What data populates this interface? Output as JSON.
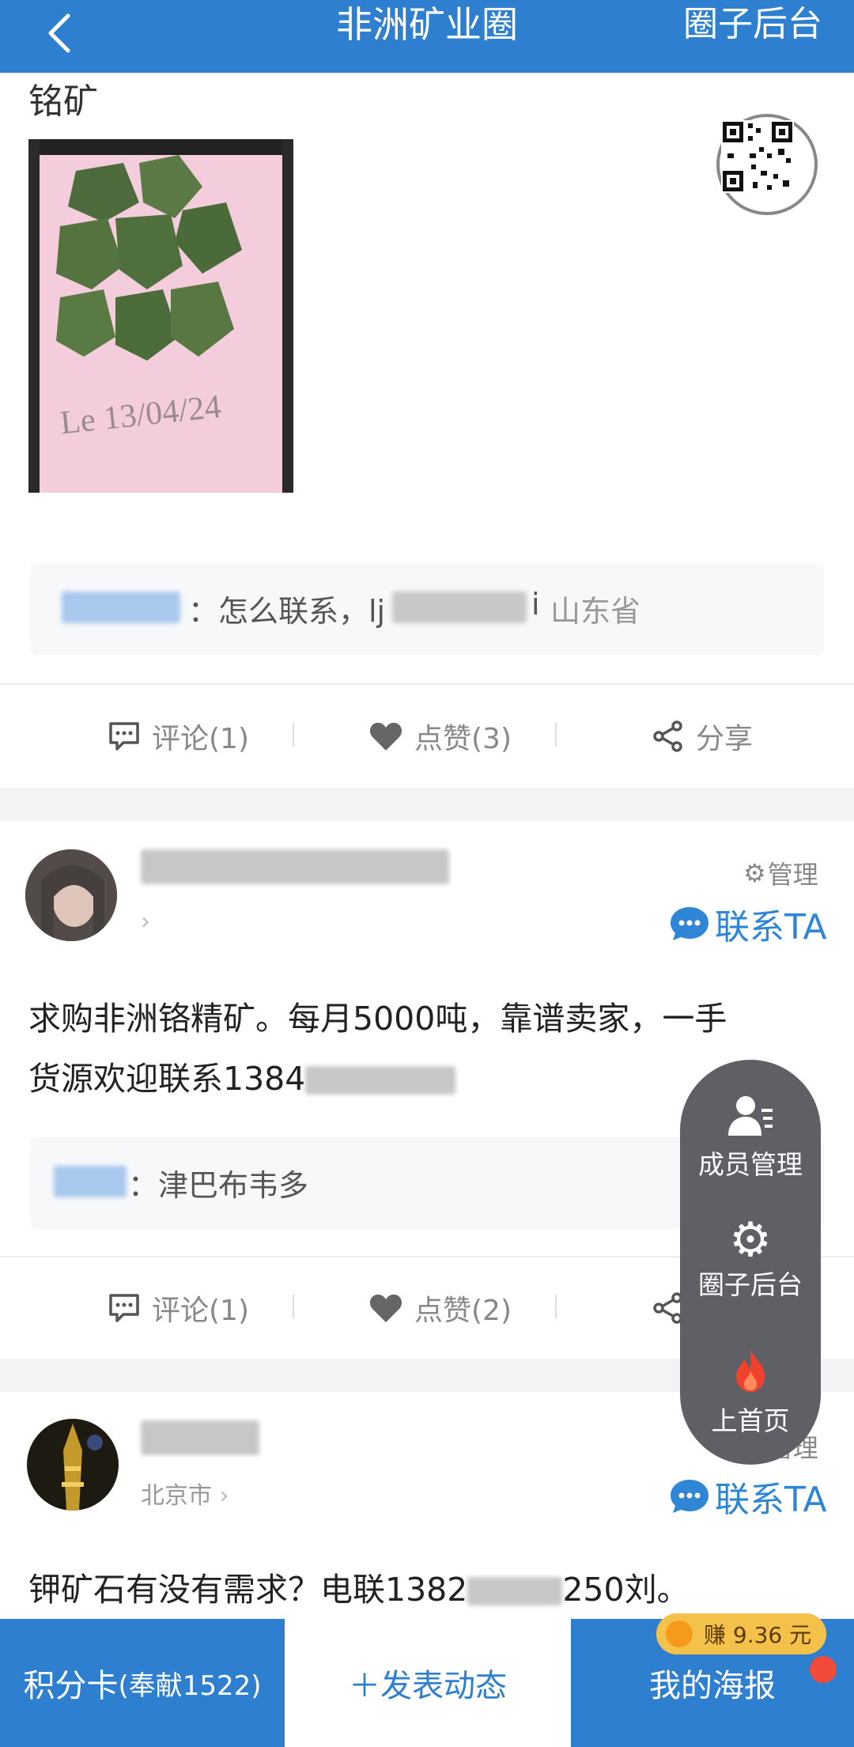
{
  "header": {
    "title": "非洲矿业圈",
    "right": "圈子后台"
  },
  "post1": {
    "title": "铭矿",
    "photo_caption": "Le 13/04/24",
    "comment": {
      "prefix": "：怎么联系，lj",
      "tail": "i",
      "location": "山东省"
    },
    "actions": {
      "comment": "评论(1)",
      "like": "点赞(3)",
      "share": "分享"
    }
  },
  "post2": {
    "manage": "管理",
    "contact": "联系TA",
    "text_line1": "求购非洲铬精矿。每月5000吨，靠谱卖家，一手",
    "text_line2": "货源欢迎联系1384",
    "comment": {
      "text": "：津巴布韦多"
    },
    "actions": {
      "comment": "评论(1)",
      "like": "点赞(2)",
      "share": "分享"
    }
  },
  "post3": {
    "location": "北京市",
    "manage": "管理",
    "contact": "联系TA",
    "text_a": "钾矿石有没有需求？电联1382",
    "text_b": "250刘。"
  },
  "float_menu": {
    "members": "成员管理",
    "admin": "圈子后台",
    "top": "上首页"
  },
  "bottom_bar": {
    "points": "积分卡",
    "points_detail": "(奉献1522)",
    "post": "＋发表动态",
    "poster": "我的海报",
    "earn_badge": "赚 9.36 元"
  },
  "colors": {
    "primary": "#2f7fd1",
    "link": "#2f86d6",
    "menu": "#5e6065"
  }
}
